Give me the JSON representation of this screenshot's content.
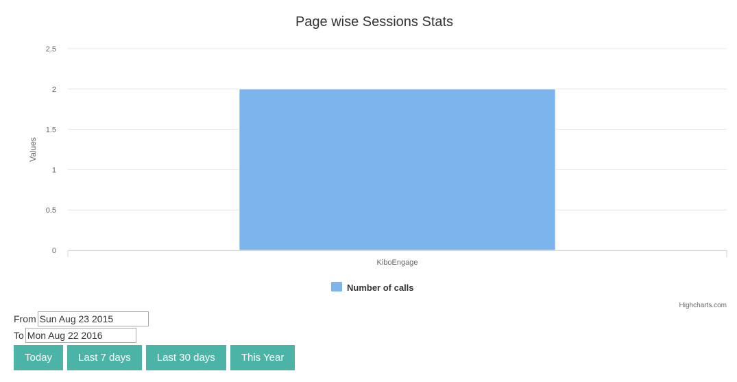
{
  "chart_data": {
    "type": "bar",
    "title": "Page wise Sessions Stats",
    "ylabel": "Values",
    "xlabel": "",
    "categories": [
      "KiboEngage"
    ],
    "series": [
      {
        "name": "Number of calls",
        "values": [
          2
        ],
        "color": "#7cb5ec"
      }
    ],
    "ylim": [
      0,
      2.5
    ],
    "yticks": [
      "0",
      "0.5",
      "1",
      "1.5",
      "2",
      "2.5"
    ],
    "grid": true,
    "legend_position": "bottom-center",
    "credits": "Highcharts.com"
  },
  "filters": {
    "from_label": "From",
    "from_value": "Sun Aug 23 2015",
    "to_label": "To",
    "to_value": "Mon Aug 22 2016"
  },
  "buttons": {
    "today": "Today",
    "last7": "Last 7 days",
    "last30": "Last 30 days",
    "this_year": "This Year"
  },
  "colors": {
    "button_bg": "#4cb3a7",
    "bar": "#7cb5ec",
    "grid": "#e6e6e6"
  }
}
